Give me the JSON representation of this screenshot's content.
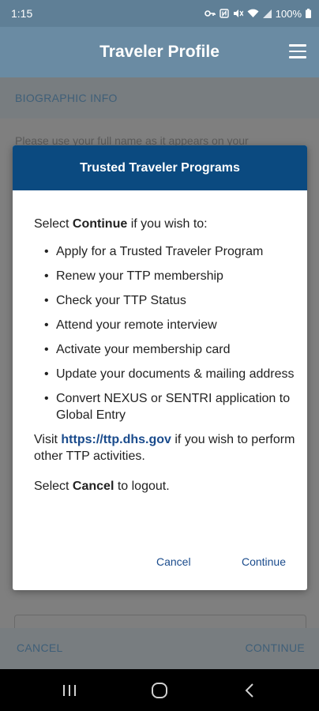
{
  "status_bar": {
    "time": "1:15",
    "battery": "100%",
    "icons": [
      "key-icon",
      "nfc-icon",
      "mute-icon",
      "wifi-icon",
      "signal-icon",
      "battery-icon"
    ]
  },
  "app_bar": {
    "title": "Traveler Profile",
    "menu_icon": "hamburger-icon"
  },
  "page": {
    "section_title": "BIOGRAPHIC INFO",
    "instruction": "Please use your full name as it appears on your"
  },
  "dialog": {
    "title": "Trusted Traveler Programs",
    "intro_prefix": "Select ",
    "intro_bold": "Continue",
    "intro_suffix": " if you wish to:",
    "bullets": [
      "Apply for a Trusted Traveler Program",
      "Renew your TTP membership",
      "Check your TTP Status",
      "Attend your remote interview",
      "Activate your membership card",
      "Update your documents & mailing address",
      "Convert NEXUS or SENTRI application to Global Entry"
    ],
    "visit_prefix": "Visit ",
    "visit_link": "https://ttp.dhs.gov",
    "visit_suffix": " if you wish to perform other TTP activities.",
    "logout_prefix": "Select ",
    "logout_bold": "Cancel",
    "logout_suffix": " to logout.",
    "cancel_label": "Cancel",
    "continue_label": "Continue"
  },
  "bottom_bar": {
    "cancel_label": "CANCEL",
    "continue_label": "CONTINUE"
  },
  "nav_bar": {
    "icons": [
      "recents-icon",
      "home-icon",
      "back-icon"
    ]
  },
  "colors": {
    "app_bar": "#6a8ba3",
    "dialog_header": "#0b4a80",
    "link": "#1a4b8c",
    "scrim": "#7f7f7f"
  }
}
